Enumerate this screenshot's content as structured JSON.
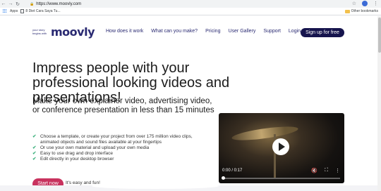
{
  "browser": {
    "url": "https://www.moovly.com",
    "bookmarks": {
      "apps_label": "Apps",
      "item_label": "8 Diet Cara Saya Tu...",
      "other_label": "Other bookmarks"
    },
    "icons": [
      "back-icon",
      "forward-icon",
      "reload-icon",
      "lock-icon",
      "star-icon",
      "menu-icon"
    ]
  },
  "header": {
    "logo_tagline": "your story begins with",
    "logo_word": "moovly",
    "nav": [
      "How does it work",
      "What can you make?",
      "Pricing",
      "User Gallery",
      "Support",
      "Login"
    ],
    "signup_label": "Sign up for free"
  },
  "hero": {
    "headline": "Impress people with your professional looking videos and presentations!",
    "subhead": "Make your own explainer video, advertising video, or conference presentation in less than 15 minutes",
    "features": [
      "Choose a template, or create your project from over 175 million video clips, animated objects and sound files available at your fingertips",
      "Or use your own material and upload your own media",
      "Easy to use drag and drop interface",
      "Edit directly in your desktop browser"
    ],
    "cta_label": "Start now",
    "cta_note": "It's easy and fun!"
  },
  "video": {
    "time": "0:00 / 0:17",
    "progress": 0
  },
  "colors": {
    "brand_navy": "#16144d",
    "cta_pink": "#c8325e",
    "check_green": "#3fb27f"
  }
}
